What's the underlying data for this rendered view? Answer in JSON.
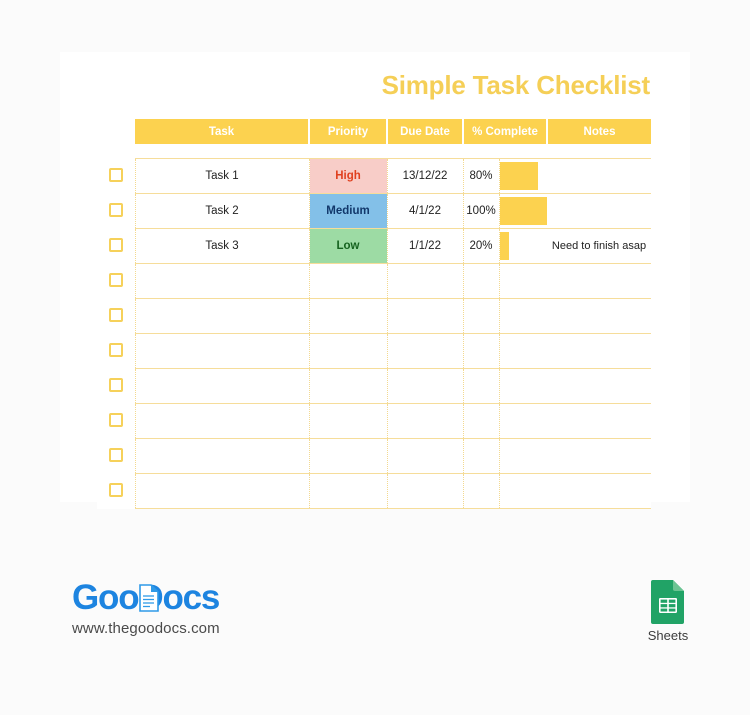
{
  "document": {
    "title": "Simple Task Checklist"
  },
  "table": {
    "columns": [
      {
        "key": "check",
        "label": ""
      },
      {
        "key": "task",
        "label": "Task"
      },
      {
        "key": "priority",
        "label": "Priority"
      },
      {
        "key": "due_date",
        "label": "Due Date"
      },
      {
        "key": "percent_complete",
        "label": "% Complete"
      },
      {
        "key": "notes",
        "label": "Notes"
      }
    ],
    "rows": [
      {
        "checked": false,
        "task": "Task 1",
        "priority": "High",
        "priority_level": "high",
        "due_date": "13/12/22",
        "due_overdue": false,
        "percent_complete": "80%",
        "percent_value": 80,
        "notes": ""
      },
      {
        "checked": false,
        "task": "Task 2",
        "priority": "Medium",
        "priority_level": "medium",
        "due_date": "4/1/22",
        "due_overdue": false,
        "percent_complete": "100%",
        "percent_value": 100,
        "notes": ""
      },
      {
        "checked": false,
        "task": "Task 3",
        "priority": "Low",
        "priority_level": "low",
        "due_date": "1/1/22",
        "due_overdue": true,
        "percent_complete": "20%",
        "percent_value": 20,
        "notes": "Need to finish asap"
      },
      {
        "checked": false,
        "task": "",
        "priority": "",
        "priority_level": "",
        "due_date": "",
        "due_overdue": false,
        "percent_complete": "",
        "percent_value": 0,
        "notes": ""
      },
      {
        "checked": false,
        "task": "",
        "priority": "",
        "priority_level": "",
        "due_date": "",
        "due_overdue": false,
        "percent_complete": "",
        "percent_value": 0,
        "notes": ""
      },
      {
        "checked": false,
        "task": "",
        "priority": "",
        "priority_level": "",
        "due_date": "",
        "due_overdue": false,
        "percent_complete": "",
        "percent_value": 0,
        "notes": ""
      },
      {
        "checked": false,
        "task": "",
        "priority": "",
        "priority_level": "",
        "due_date": "",
        "due_overdue": false,
        "percent_complete": "",
        "percent_value": 0,
        "notes": ""
      },
      {
        "checked": false,
        "task": "",
        "priority": "",
        "priority_level": "",
        "due_date": "",
        "due_overdue": false,
        "percent_complete": "",
        "percent_value": 0,
        "notes": ""
      },
      {
        "checked": false,
        "task": "",
        "priority": "",
        "priority_level": "",
        "due_date": "",
        "due_overdue": false,
        "percent_complete": "",
        "percent_value": 0,
        "notes": ""
      },
      {
        "checked": false,
        "task": "",
        "priority": "",
        "priority_level": "",
        "due_date": "",
        "due_overdue": false,
        "percent_complete": "",
        "percent_value": 0,
        "notes": ""
      }
    ]
  },
  "footer": {
    "brand_name": "GooDocs",
    "brand_name_part1": "Goo",
    "brand_name_part2": "Docs",
    "url": "www.thegoodocs.com",
    "app_label": "Sheets",
    "doc_icon_name": "document-icon",
    "sheets_icon_name": "google-sheets-icon"
  },
  "colors": {
    "accent_yellow": "#fcd24f",
    "title_yellow": "#f5cf57",
    "grid_line": "#f6dd9a",
    "priority_high_bg": "#f8cdc8",
    "priority_high_text": "#e0401f",
    "priority_medium_bg": "#83c0e8",
    "priority_medium_text": "#12386b",
    "priority_low_bg": "#9ddba4",
    "priority_low_text": "#16631f",
    "overdue_text": "#e8502a",
    "brand_blue": "#1d84e0",
    "sheets_green": "#21a366",
    "page_bg": "#fbfbfb"
  }
}
